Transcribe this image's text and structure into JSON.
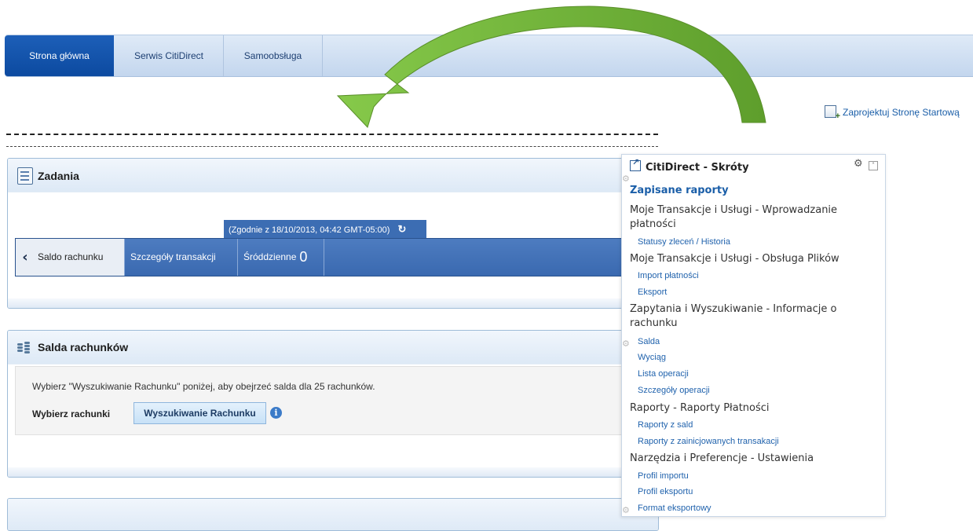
{
  "nav": {
    "tabs": [
      {
        "label": "Strona główna",
        "active": true
      },
      {
        "label": "Serwis CitiDirect",
        "active": false
      },
      {
        "label": "Samoobsługa",
        "active": false
      }
    ]
  },
  "design_link": "Zaprojektuj Stronę Startową",
  "tasks_panel": {
    "title": "Zadania",
    "status": "(Zgodnie z 18/10/2013, 04:42 GMT-05:00)",
    "tabs": [
      "Saldo rachunku",
      "Szczegóły transakcji",
      "Śróddzienne"
    ],
    "intraday_count": "0"
  },
  "balances_panel": {
    "title": "Salda rachunków",
    "instruction": "Wybierz \"Wyszukiwanie Rachunku\" poniżej, aby obejrzeć salda dla 25 rachunków.",
    "select_label": "Wybierz rachunki",
    "search_button": "Wyszukiwanie Rachunku"
  },
  "shortcuts": {
    "title": "CitiDirect - Skróty",
    "saved_reports": "Zapisane raporty",
    "sections": [
      {
        "title": "Moje Transakcje i Usługi - Wprowadzanie płatności",
        "items": [
          "Statusy zleceń / Historia"
        ]
      },
      {
        "title": "Moje Transakcje i Usługi - Obsługa Plików",
        "items": [
          "Import płatności",
          "Eksport"
        ]
      },
      {
        "title": "Zapytania i Wyszukiwanie - Informacje o rachunku",
        "items": [
          "Salda",
          "Wyciąg",
          "Lista operacji",
          "Szczegóły operacji"
        ]
      },
      {
        "title": "Raporty - Raporty Płatności",
        "items": [
          "Raporty z sald",
          "Raporty z zainicjowanych transakacji"
        ]
      },
      {
        "title": "Narzędzia i Preferencje - Ustawienia",
        "items": [
          "Profil importu",
          "Profil eksportu",
          "Format eksportowy"
        ]
      }
    ]
  },
  "colors": {
    "nav_active": "#0c4aa0",
    "carousel": "#3a69b0",
    "link": "#1a5ea8",
    "arrow_green": "#7dc242"
  }
}
